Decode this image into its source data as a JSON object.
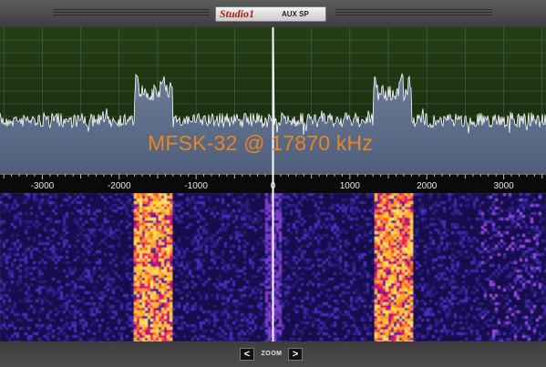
{
  "header": {
    "title": "Studio1",
    "output_label": "AUX SP"
  },
  "spectrum": {
    "annotation": "MFSK-32 @ 17870 kHz",
    "axis_ticks": [
      "-3000",
      "-2000",
      "-1000",
      "0",
      "1000",
      "2000",
      "3000"
    ],
    "axis_tick_values_hz": [
      -3000,
      -2000,
      -1000,
      0,
      1000,
      2000,
      3000
    ],
    "frequency_span_hz": [
      -3550,
      3550
    ],
    "signals": [
      {
        "name": "lower sideband MFSK",
        "from_hz": -1800,
        "to_hz": -1300
      },
      {
        "name": "upper sideband MFSK",
        "from_hz": 1300,
        "to_hz": 1800
      }
    ],
    "colors": {
      "trace_area": "#1f3a12",
      "below_trace": "#5c6e8a",
      "centre_marker": "#ffffff",
      "annotation": "#e8861f"
    }
  },
  "zoom": {
    "label": "ZOOM",
    "out": "<",
    "in": ">"
  }
}
